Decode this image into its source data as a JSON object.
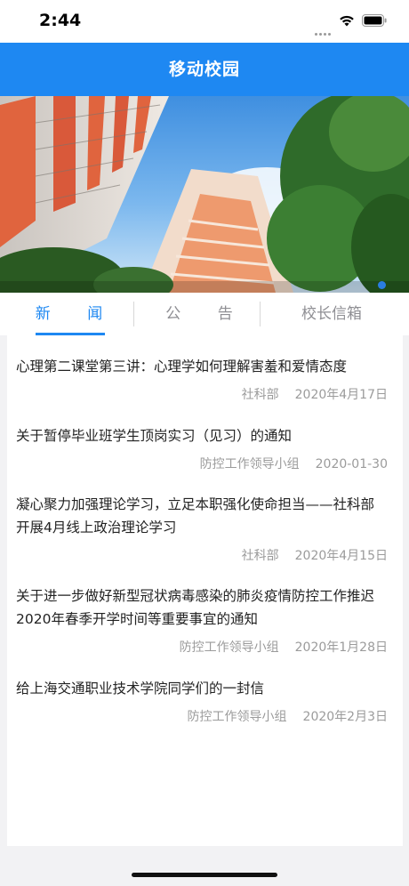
{
  "status_bar": {
    "time": "2:44",
    "icons": [
      "signal-icon",
      "wifi-icon",
      "battery-icon"
    ]
  },
  "header": {
    "title": "移动校园"
  },
  "banner": {
    "image": "campus-buildings-photo",
    "active_slide_indicator": "banner-dot"
  },
  "tabs": [
    {
      "label": "新 闻",
      "active": true
    },
    {
      "label": "公 告",
      "active": false
    },
    {
      "label": "校长信箱",
      "active": false
    }
  ],
  "news": [
    {
      "title": "心理第二课堂第三讲：心理学如何理解害羞和爱情态度",
      "source": "社科部",
      "date": "2020年4月17日"
    },
    {
      "title": "关于暂停毕业班学生顶岗实习（见习）的通知",
      "source": "防控工作领导小组",
      "date": "2020-01-30"
    },
    {
      "title": "凝心聚力加强理论学习，立足本职强化使命担当——社科部开展4月线上政治理论学习",
      "source": "社科部",
      "date": "2020年4月15日"
    },
    {
      "title": "关于进一步做好新型冠状病毒感染的肺炎疫情防控工作推迟2020年春季开学时间等重要事宜的通知",
      "source": "防控工作领导小组",
      "date": "2020年1月28日"
    },
    {
      "title": "给上海交通职业技术学院同学们的一封信",
      "source": "防控工作领导小组",
      "date": "2020年2月3日"
    }
  ],
  "colors": {
    "brand_blue": "#1e88f2",
    "text_primary": "#222222",
    "text_secondary": "#9b9b9b",
    "background": "#f2f2f4"
  }
}
